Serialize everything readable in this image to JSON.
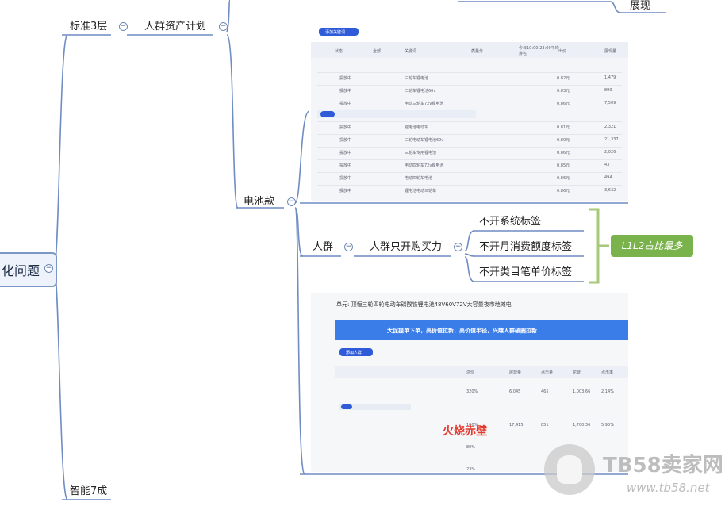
{
  "mindmap": {
    "root": "化问题",
    "branch_standard": "标准3层",
    "branch_smart": "智能7成",
    "plan": "人群资产计划",
    "top_item": "展现",
    "battery": "电池款",
    "crowd": "人群",
    "crowd_buy": "人群只开购买力",
    "labels": [
      "不开系统标签",
      "不开月消费额度标签",
      "不开类目笔单价标签"
    ],
    "summary": "L1L2占比最多"
  },
  "screenshot1": {
    "add_button": "添加关键词",
    "headers": [
      "状态",
      "全部",
      "关键词",
      "质量分",
      "今日10:00-23:00平均排名",
      "出价",
      "展现量"
    ],
    "rows": [
      {
        "status": "投放中",
        "keyword": "三轮车锂电池",
        "bid": "0.82元",
        "impr": "1,479"
      },
      {
        "status": "投放中",
        "keyword": "二轮车锂电池60v",
        "bid": "0.83元",
        "impr": "899"
      },
      {
        "status": "投放中",
        "keyword": "电动三轮车72v锂电池",
        "bid": "0.86元",
        "impr": "7,509"
      },
      {
        "status": "投放中",
        "keyword": "锂电池电动车",
        "bid": "0.81元",
        "impr": "2,321"
      },
      {
        "status": "投放中",
        "keyword": "三轮电动车锂电池60v",
        "bid": "0.80元",
        "impr": "21,337"
      },
      {
        "status": "投放中",
        "keyword": "三轮车专用锂电池",
        "bid": "0.86元",
        "impr": "2,026"
      },
      {
        "status": "投放中",
        "keyword": "电动四轮车72v锂电池",
        "bid": "0.85元",
        "impr": "43"
      },
      {
        "status": "投放中",
        "keyword": "电动四轮车电池",
        "bid": "0.86元",
        "impr": "494"
      },
      {
        "status": "投放中",
        "keyword": "锂电池电动三轮车",
        "bid": "0.86元",
        "impr": "3,632"
      }
    ]
  },
  "screenshot2": {
    "title": "单元: 顶恒三轮四轮电动车磷酸铁锂电池48V60V72V大容量夜市地摊电",
    "banner": "大促提单下单，高价值拉新，高价值半径，兴趣人群破圈拉新",
    "add_button": "添加人群",
    "headers": [
      "溢价",
      "展现量",
      "点击量",
      "花费",
      "点击率"
    ],
    "row1": {
      "premium": "320%",
      "impr": "6,045",
      "clicks": "465",
      "cost": "1,003.66",
      "ctr": "2.14%"
    },
    "row2": {
      "premium": "100%",
      "impr": "17,415",
      "clicks": "851",
      "cost": "1,700.36",
      "ctr": "5.95%"
    },
    "row3": {
      "premium": "80%"
    },
    "row4": {
      "premium": "23%"
    },
    "annotation": "火烧赤壁"
  },
  "watermark": {
    "name": "TB58卖家网",
    "url": "www.tb58.net"
  },
  "colors": {
    "line": "#6f8cc3",
    "bracket": "#a6c97a",
    "tag": "#7ab24b",
    "accent": "#2f5bd8",
    "annotation": "#e2392e"
  }
}
